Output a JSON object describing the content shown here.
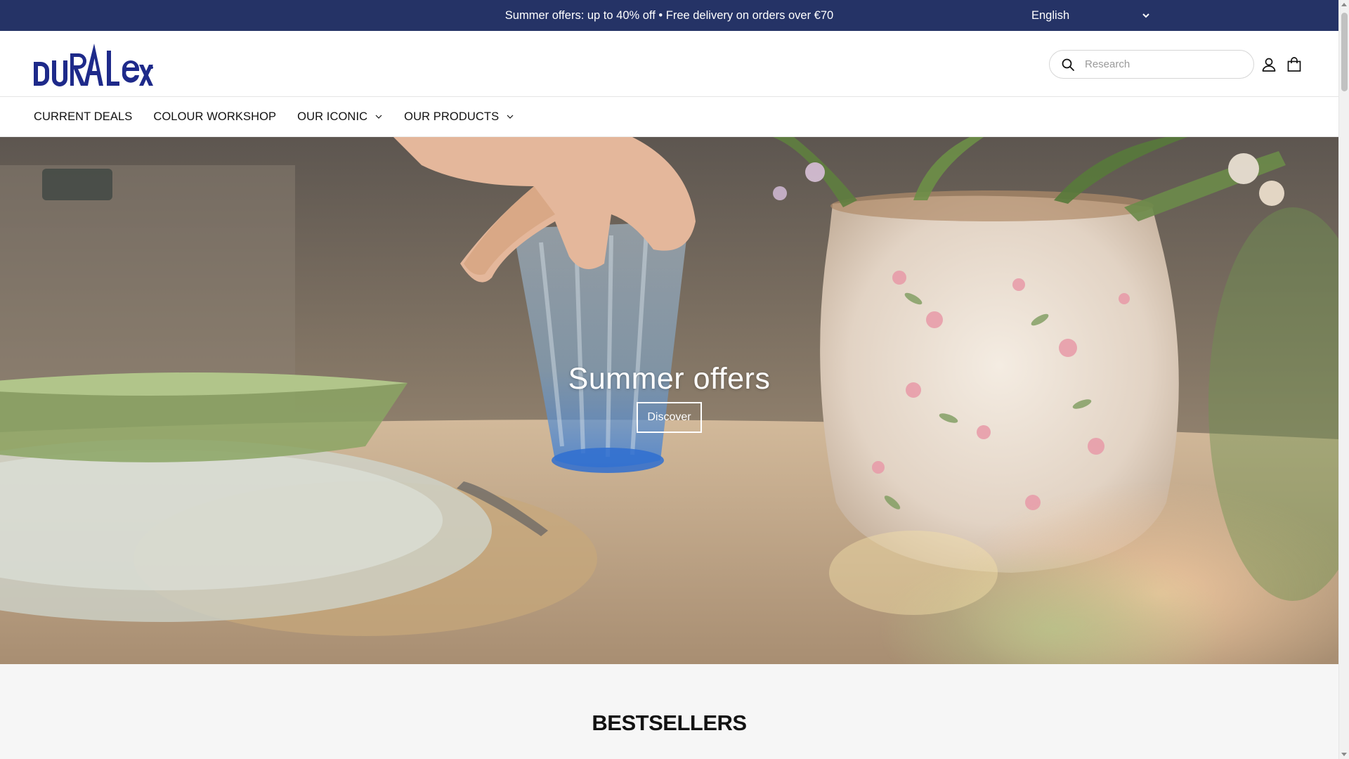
{
  "announcement": {
    "text": "Summer offers: up to 40% off • Free delivery on orders over €70",
    "language": "English"
  },
  "header": {
    "brand": "DURALEX",
    "search_placeholder": "Research"
  },
  "nav": {
    "items": [
      {
        "label": "CURRENT DEALS",
        "dropdown": false
      },
      {
        "label": "COLOUR WORKSHOP",
        "dropdown": false
      },
      {
        "label": "OUR ICONIC",
        "dropdown": true
      },
      {
        "label": "OUR PRODUCTS",
        "dropdown": true
      }
    ]
  },
  "hero": {
    "title": "Summer offers",
    "button": "Discover"
  },
  "bestsellers": {
    "title": "BESTSELLERS"
  },
  "colors": {
    "announce_bg": "#253366",
    "brand_blue": "#1e2a8a"
  },
  "icons": [
    "chevron-down-icon",
    "search-icon",
    "account-icon",
    "cart-icon"
  ]
}
